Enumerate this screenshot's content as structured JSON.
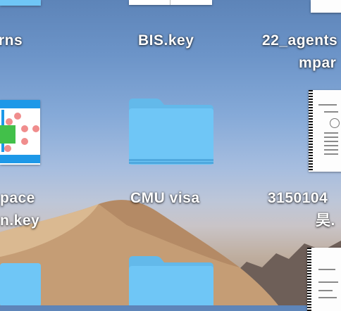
{
  "desktop": {
    "items": [
      {
        "label_line1": "rns",
        "label_line2": "",
        "icon": "keynote-file-icon"
      },
      {
        "label_line1": "BIS.key",
        "label_line2": "",
        "icon": "keynote-file-icon"
      },
      {
        "label_line1": "22_agents",
        "label_line2": "mpar",
        "icon": "document-icon"
      },
      {
        "label_line1": "pace",
        "label_line2": "n.key",
        "icon": "keynote-thumbnail-icon"
      },
      {
        "label_line1": "CMU visa",
        "label_line2": "",
        "icon": "folder-icon"
      },
      {
        "label_line1": "3150104",
        "label_line2": "昊.",
        "icon": "pdf-document-icon"
      },
      {
        "label_line1": "",
        "label_line2": "",
        "icon": "folder-icon"
      },
      {
        "label_line1": "",
        "label_line2": "",
        "icon": "folder-icon"
      },
      {
        "label_line1": "",
        "label_line2": "",
        "icon": "pdf-document-icon"
      }
    ]
  },
  "colors": {
    "folder_body": "#6fc6f6",
    "folder_tab": "#63b9ea",
    "thumbnail_accent_blue": "#1d98e8",
    "thumbnail_accent_green": "#42c04a",
    "thumbnail_accent_pink": "#f08d8d"
  }
}
